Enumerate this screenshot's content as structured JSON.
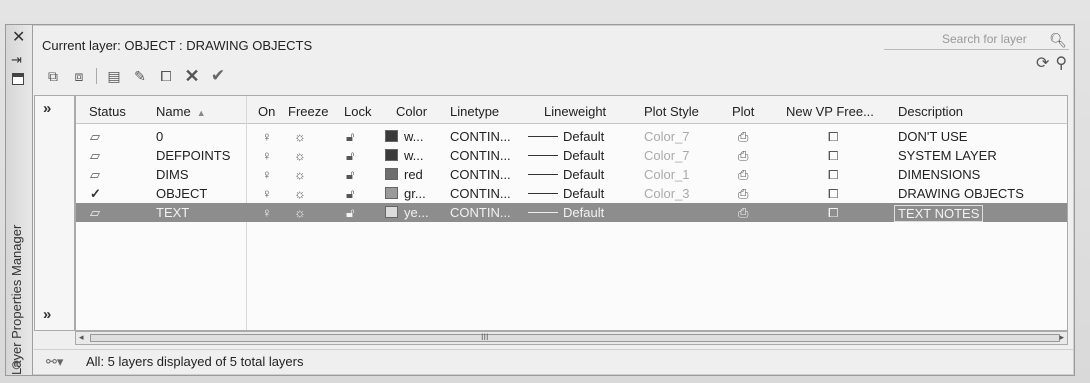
{
  "window": {
    "side_title": "Layer Properties Manager",
    "current_layer": "Current layer: OBJECT : DRAWING OBJECTS",
    "search_placeholder": "Search for layer"
  },
  "columns": [
    "Status",
    "Name",
    "On",
    "Freeze",
    "Lock",
    "Color",
    "Linetype",
    "Lineweight",
    "Plot Style",
    "Plot",
    "New VP Free...",
    "Description"
  ],
  "layers": [
    {
      "name": "0",
      "color_name": "w...",
      "swatch": "#3a3a3a",
      "linetype": "CONTIN...",
      "lineweight": "Default",
      "plot_style": "Color_7",
      "description": "DON'T USE",
      "current": false,
      "selected": false
    },
    {
      "name": "DEFPOINTS",
      "color_name": "w...",
      "swatch": "#3a3a3a",
      "linetype": "CONTIN...",
      "lineweight": "Default",
      "plot_style": "Color_7",
      "description": "SYSTEM LAYER",
      "current": false,
      "selected": false
    },
    {
      "name": "DIMS",
      "color_name": "red",
      "swatch": "#6e6e6e",
      "linetype": "CONTIN...",
      "lineweight": "Default",
      "plot_style": "Color_1",
      "description": "DIMENSIONS",
      "current": false,
      "selected": false
    },
    {
      "name": "OBJECT",
      "color_name": "gr...",
      "swatch": "#9a9a9a",
      "linetype": "CONTIN...",
      "lineweight": "Default",
      "plot_style": "Color_3",
      "description": "DRAWING OBJECTS",
      "current": true,
      "selected": false
    },
    {
      "name": "TEXT",
      "color_name": "ye...",
      "swatch": "#dcdcdc",
      "linetype": "CONTIN...",
      "lineweight": "Default",
      "plot_style": "",
      "description": "TEXT NOTES",
      "current": false,
      "selected": true
    }
  ],
  "status_text": "All: 5 layers displayed of 5 total layers",
  "scroll_marker": "III",
  "icons": {
    "close": "close-icon",
    "pin": "auto-hide-icon",
    "properties": "properties-icon",
    "search": "search-icon",
    "refresh": "refresh-icon",
    "settings": "settings-icon",
    "new_property_filter": "new-property-filter-icon",
    "new_group_filter": "new-group-filter-icon",
    "layer_states": "layer-states-manager-icon",
    "new_layer": "new-layer-icon",
    "new_layer_vp_frozen": "new-layer-vp-frozen-icon",
    "delete_layer": "delete-layer-icon",
    "set_current": "set-current-icon",
    "on": "lightbulb-icon",
    "freeze": "sun-icon",
    "lock": "padlock-icon",
    "plot": "printer-icon",
    "vp_freeze": "vp-freeze-icon",
    "filter": "filter-icon"
  }
}
